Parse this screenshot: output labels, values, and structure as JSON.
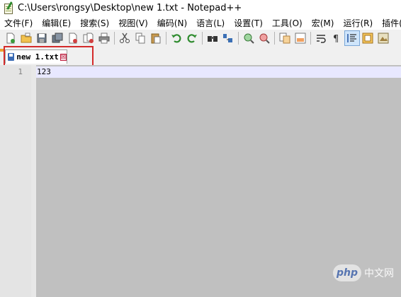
{
  "window": {
    "title": "C:\\Users\\rongsy\\Desktop\\new 1.txt - Notepad++"
  },
  "menu": [
    "文件(F)",
    "编辑(E)",
    "搜索(S)",
    "视图(V)",
    "编码(N)",
    "语言(L)",
    "设置(T)",
    "工具(O)",
    "宏(M)",
    "运行(R)",
    "插件(P)"
  ],
  "toolbar": [
    "new-file-icon",
    "open-file-icon",
    "save-icon",
    "save-all-icon",
    "close-icon",
    "close-all-icon",
    "print-icon",
    "cut-icon",
    "copy-icon",
    "paste-icon",
    "undo-icon",
    "redo-icon",
    "find-icon",
    "replace-icon",
    "zoom-in-icon",
    "zoom-out-icon",
    "sync-vertical-icon",
    "sync-horizontal-icon",
    "word-wrap-icon",
    "show-all-chars-icon",
    "indent-guide-icon",
    "user-language-icon",
    "doc-map-icon"
  ],
  "tab": {
    "label": "new 1.txt",
    "close_glyph": "☒"
  },
  "editor": {
    "line_number": "1",
    "line_text": "123"
  },
  "watermark": {
    "logo": "php",
    "text": "中文网"
  },
  "colors": {
    "highlight_box": "#d42b2b",
    "editor_bg": "#c0c0c0",
    "current_line": "#e8e8ff"
  }
}
